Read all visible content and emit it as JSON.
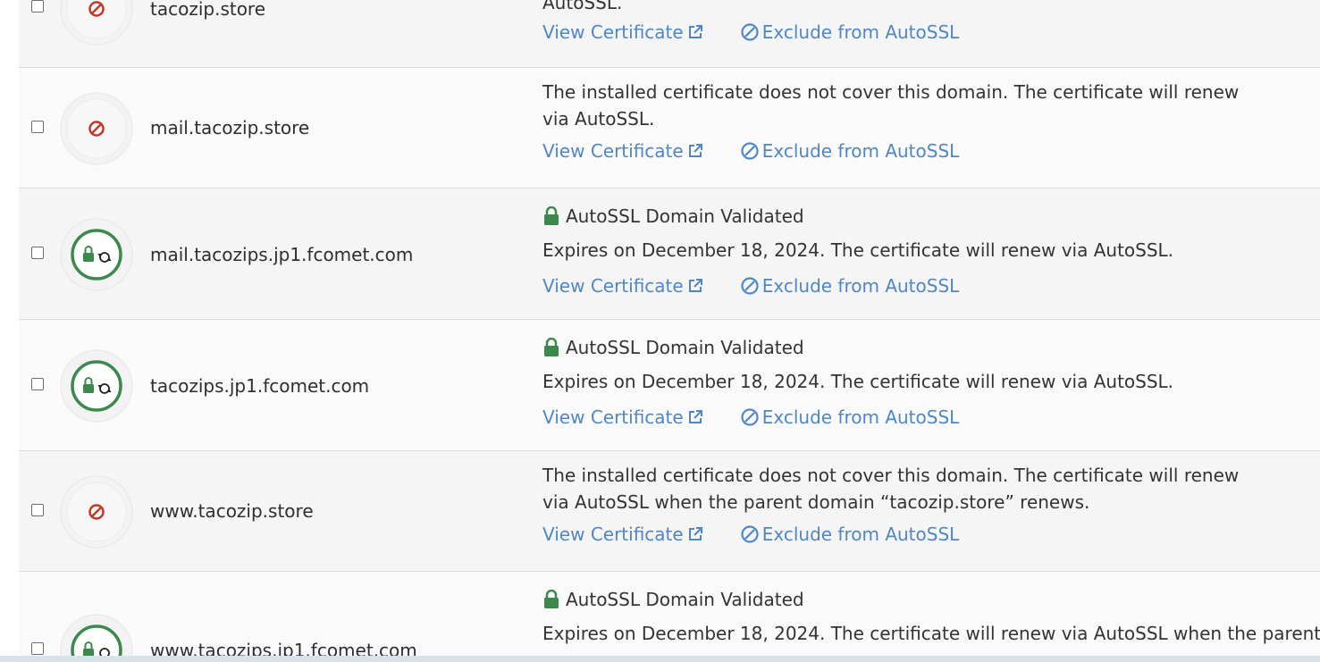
{
  "links": {
    "view_certificate": "View Certificate",
    "exclude": "Exclude from AutoSSL"
  },
  "colors": {
    "link": "#4f87c6",
    "ok": "#3c8a4b",
    "error": "#c0392b"
  },
  "rows": [
    {
      "domain": "tacozip.store",
      "status": "error",
      "message": "AutoSSL."
    },
    {
      "domain": "mail.tacozip.store",
      "status": "error",
      "message": "The installed certificate does not cover this domain. The certificate will renew via AutoSSL."
    },
    {
      "domain": "mail.tacozips.jp1.fcomet.com",
      "status": "ok",
      "validated": "AutoSSL Domain Validated",
      "message": "Expires on December 18, 2024. The certificate will renew via AutoSSL."
    },
    {
      "domain": "tacozips.jp1.fcomet.com",
      "status": "ok",
      "validated": "AutoSSL Domain Validated",
      "message": "Expires on December 18, 2024. The certificate will renew via AutoSSL."
    },
    {
      "domain": "www.tacozip.store",
      "status": "error",
      "message": "The installed certificate does not cover this domain. The certificate will renew via AutoSSL when the parent domain “tacozip.store” renews."
    },
    {
      "domain": "www.tacozips.jp1.fcomet.com",
      "status": "ok",
      "validated": "AutoSSL Domain Validated",
      "message": "Expires on December 18, 2024. The certificate will renew via AutoSSL when the parent"
    }
  ]
}
